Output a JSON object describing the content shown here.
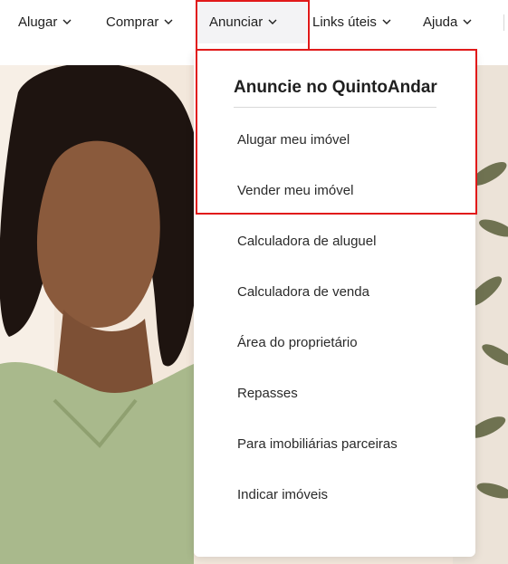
{
  "nav": {
    "items": [
      {
        "label": "Alugar"
      },
      {
        "label": "Comprar"
      },
      {
        "label": "Anunciar"
      },
      {
        "label": "Links úteis"
      },
      {
        "label": "Ajuda"
      }
    ]
  },
  "dropdown": {
    "title": "Anuncie no QuintoAndar",
    "items": [
      {
        "label": "Alugar meu imóvel"
      },
      {
        "label": "Vender meu imóvel"
      },
      {
        "label": "Calculadora de aluguel"
      },
      {
        "label": "Calculadora de venda"
      },
      {
        "label": "Área do proprietário"
      },
      {
        "label": "Repasses"
      },
      {
        "label": "Para imobiliárias parceiras"
      },
      {
        "label": "Indicar imóveis"
      }
    ]
  },
  "icons": {
    "chevron": "chevron-down-icon"
  },
  "colors": {
    "highlight": "#e11919",
    "active_tab_bg": "#f3f3f5",
    "text": "#1f1f1f"
  }
}
